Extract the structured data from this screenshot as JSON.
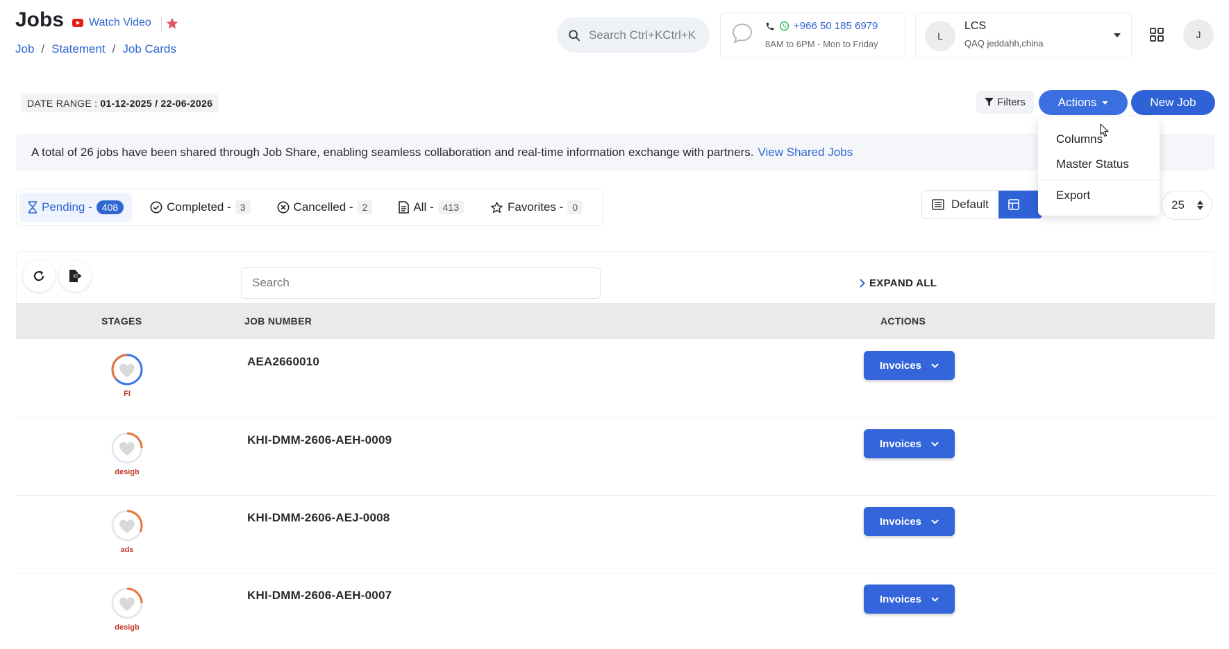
{
  "header": {
    "title": "Jobs",
    "watch_video": "Watch Video",
    "breadcrumbs": [
      "Job",
      "Statement",
      "Job Cards"
    ],
    "search_placeholder": "Search  Ctrl+KCtrl+K",
    "support": {
      "phone": "+966 50 185 6979",
      "hours": "8AM to 6PM - Mon to Friday"
    },
    "user": {
      "initial": "L",
      "name": "LCS",
      "location": "QAQ jeddahh,china"
    },
    "profile_initial": "J"
  },
  "toolbar": {
    "date_range_label": "DATE RANGE :",
    "date_range_value": "01-12-2025 / 22-06-2026",
    "filters": "Filters",
    "actions": "Actions",
    "new_job": "New Job"
  },
  "actions_menu": [
    "Columns",
    "Master Status",
    "Export"
  ],
  "banner": {
    "text": "A total of 26 jobs have been shared through Job Share, enabling seamless collaboration and real-time information exchange with partners.",
    "link": "View Shared Jobs"
  },
  "status_tabs": [
    {
      "label": "Pending -",
      "count": "408",
      "icon": "hourglass-icon",
      "active": true
    },
    {
      "label": "Completed -",
      "count": "3",
      "icon": "check-circle-icon"
    },
    {
      "label": "Cancelled -",
      "count": "2",
      "icon": "x-circle-icon"
    },
    {
      "label": "All -",
      "count": "413",
      "icon": "document-icon"
    },
    {
      "label": "Favorites -",
      "count": "0",
      "icon": "star-icon"
    }
  ],
  "view_toggle": {
    "default": "Default"
  },
  "page_size": "25",
  "table": {
    "search_placeholder": "Search",
    "expand_all": "EXPAND ALL",
    "columns": [
      "STAGES",
      "JOB NUMBER",
      "ACTIONS"
    ],
    "rows": [
      {
        "stage": "FI",
        "job_number": "AEA2660010",
        "action": "Invoices"
      },
      {
        "stage": "desigb",
        "job_number": "KHI-DMM-2606-AEH-0009",
        "action": "Invoices"
      },
      {
        "stage": "ads",
        "job_number": "KHI-DMM-2606-AEJ-0008",
        "action": "Invoices"
      },
      {
        "stage": "desigb",
        "job_number": "KHI-DMM-2606-AEH-0007",
        "action": "Invoices"
      }
    ]
  },
  "colors": {
    "primary": "#2f62d6",
    "link": "#2f66d0",
    "stage_label": "#c0392b",
    "ring_orange": "#e8743b",
    "ring_blue": "#3b78e7"
  }
}
